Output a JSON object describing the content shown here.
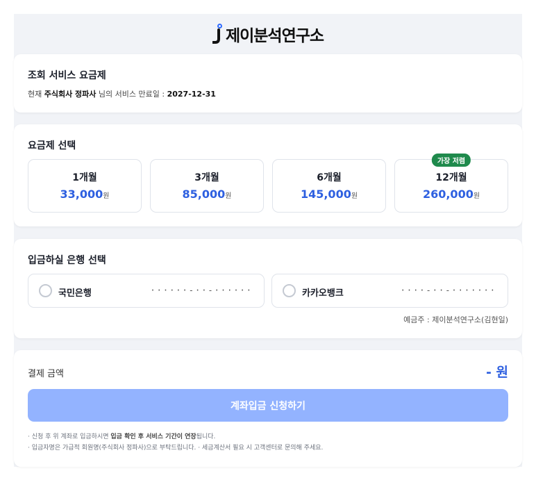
{
  "brand": {
    "name": "제이분석연구소",
    "logo_icon": "j-logo-icon",
    "accent": "#2f6bff"
  },
  "subscription": {
    "title": "조회 서비스 요금제",
    "expiry_prefix": "현재 ",
    "company": "주식회사 정파사",
    "expiry_mid": " 님의 서비스 만료일 : ",
    "expiry_date": "2027-12-31"
  },
  "plans": {
    "title": "요금제 선택",
    "currency": "원",
    "items": [
      {
        "name": "1개월",
        "price": "33,000"
      },
      {
        "name": "3개월",
        "price": "85,000"
      },
      {
        "name": "6개월",
        "price": "145,000"
      },
      {
        "name": "12개월",
        "price": "260,000",
        "badge": "가장 저렴"
      }
    ]
  },
  "banks": {
    "title": "입금하실 은행 선택",
    "items": [
      {
        "name": "국민은행",
        "account": "······-··-······"
      },
      {
        "name": "카카오뱅크",
        "account": "····-··-·······"
      }
    ],
    "holder": "예금주 : 제이분석연구소(김현일)"
  },
  "payment": {
    "label": "결제 금액",
    "amount": "- 원",
    "submit_label": "계좌입금 신청하기",
    "note1_a": "· 신청 후 위 계좌로 입금하시면 ",
    "note1_b": "입금 확인 후 서비스 기간이 연장",
    "note1_c": "됩니다.",
    "note2": "· 입금자명은 가급적 회원명(주식회사 정파사)으로 부탁드립니다. · 세금계산서 필요 시 고객센터로 문의해 주세요."
  },
  "colors": {
    "price": "#2d5fe0",
    "badge": "#1f8a4c",
    "button_disabled": "#93b3ff"
  }
}
